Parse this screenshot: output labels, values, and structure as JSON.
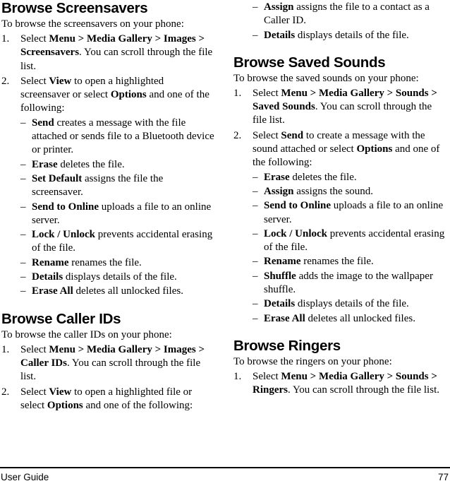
{
  "document": {
    "footer": {
      "left_label": "User Guide",
      "page_number": "77"
    }
  },
  "left_column": {
    "sections": [
      {
        "heading": "Browse Screensavers",
        "intro": "To browse the screensavers on your phone:",
        "steps": [
          {
            "number": "1.",
            "lead": "Select ",
            "bold": "Menu > Media Gallery > Images > Screensavers",
            "tail": ". You can scroll through the file list.",
            "subs": []
          },
          {
            "number": "2.",
            "lead": "Select ",
            "bold": "View",
            "mid": " to open a highlighted screensaver or select ",
            "bold2": "Options",
            "tail": " and one of the following:",
            "subs": [
              {
                "term": "Send",
                "desc": " creates a message with the file attached or sends file to a Bluetooth device or printer."
              },
              {
                "term": "Erase",
                "desc": " deletes the file."
              },
              {
                "term": "Set Default",
                "desc": " assigns the file the screensaver."
              },
              {
                "term": "Send to Online",
                "desc": " uploads a file to an online server."
              },
              {
                "term": "Lock / Unlock",
                "desc": " prevents accidental erasing of the file."
              },
              {
                "term": "Rename",
                "desc": " renames the file."
              },
              {
                "term": "Details",
                "desc": " displays details of the file."
              },
              {
                "term": "Erase All",
                "desc": " deletes all unlocked files."
              }
            ]
          }
        ]
      },
      {
        "heading": "Browse Caller IDs",
        "intro": "To browse the caller IDs on your phone:",
        "steps": [
          {
            "number": "1.",
            "lead": "Select ",
            "bold": "Menu > Media Gallery > Images > Caller IDs",
            "tail": ". You can scroll through the file list.",
            "subs": []
          },
          {
            "number": "2.",
            "lead": "Select ",
            "bold": "View",
            "mid": " to open a highlighted file or select ",
            "bold2": "Options",
            "tail": " and one of the following:",
            "subs": []
          }
        ]
      }
    ]
  },
  "right_column": {
    "continued_subs": [
      {
        "term": "Assign",
        "desc": " assigns the file to a contact as a Caller ID."
      },
      {
        "term": "Details",
        "desc": " displays details of the file."
      }
    ],
    "sections": [
      {
        "heading": "Browse Saved Sounds",
        "intro": "To browse the saved sounds on your phone:",
        "steps": [
          {
            "number": "1.",
            "lead": "Select ",
            "bold": "Menu > Media Gallery > Sounds > Saved Sounds",
            "tail": ". You can scroll through the file list.",
            "subs": []
          },
          {
            "number": "2.",
            "lead": "Select ",
            "bold": "Send",
            "mid": " to create a message with the sound attached or select ",
            "bold2": "Options",
            "tail": " and one of the following:",
            "subs": [
              {
                "term": "Erase",
                "desc": " deletes the file."
              },
              {
                "term": "Assign",
                "desc": " assigns the sound."
              },
              {
                "term": "Send to Online",
                "desc": " uploads a file to an online server."
              },
              {
                "term": "Lock / Unlock",
                "desc": " prevents accidental erasing of the file."
              },
              {
                "term": "Rename",
                "desc": " renames the file."
              },
              {
                "term": "Shuffle",
                "desc": " adds the image to the wallpaper shuffle."
              },
              {
                "term": "Details",
                "desc": " displays details of the file."
              },
              {
                "term": "Erase All",
                "desc": " deletes all unlocked files."
              }
            ]
          }
        ]
      },
      {
        "heading": "Browse Ringers",
        "intro": "To browse the ringers on your phone:",
        "steps": [
          {
            "number": "1.",
            "lead": "Select ",
            "bold": "Menu > Media Gallery > Sounds > Ringers",
            "tail": ". You can scroll through the file list.",
            "subs": []
          }
        ]
      }
    ]
  }
}
